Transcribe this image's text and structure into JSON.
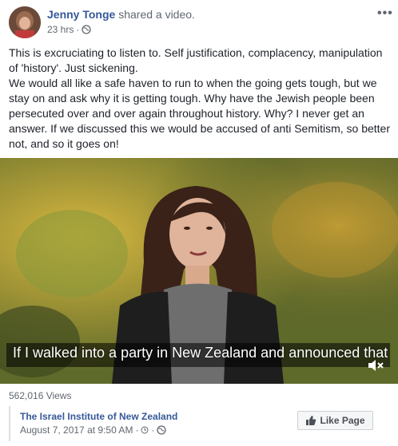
{
  "post": {
    "author": "Jenny Tonge",
    "action": "shared a video.",
    "time": "23 hrs",
    "separator": "·",
    "more_label": "•••",
    "text_lines": [
      "This is excruciating to listen to. Self justification, complacency, manipulation of 'history'. Just sickening.",
      "We would all like a safe haven to run to when the going gets tough, but we stay on and ask why it is getting tough. Why have the Jewish people been persecuted over and over again throughout history. Why? I never get an answer. If we discussed this we would be accused of anti Semitism, so better not, and so it goes on!"
    ]
  },
  "video": {
    "caption": "If I walked into a party in New Zealand and announced that",
    "views": "562,016 Views"
  },
  "attribution": {
    "page_name": "The Israel Institute of New Zealand",
    "date": "August 7, 2017 at 9:50 AM",
    "separator": "·",
    "like_page_label": "Like Page"
  },
  "colors": {
    "link": "#365899",
    "meta": "#616770",
    "text": "#1d2129"
  }
}
